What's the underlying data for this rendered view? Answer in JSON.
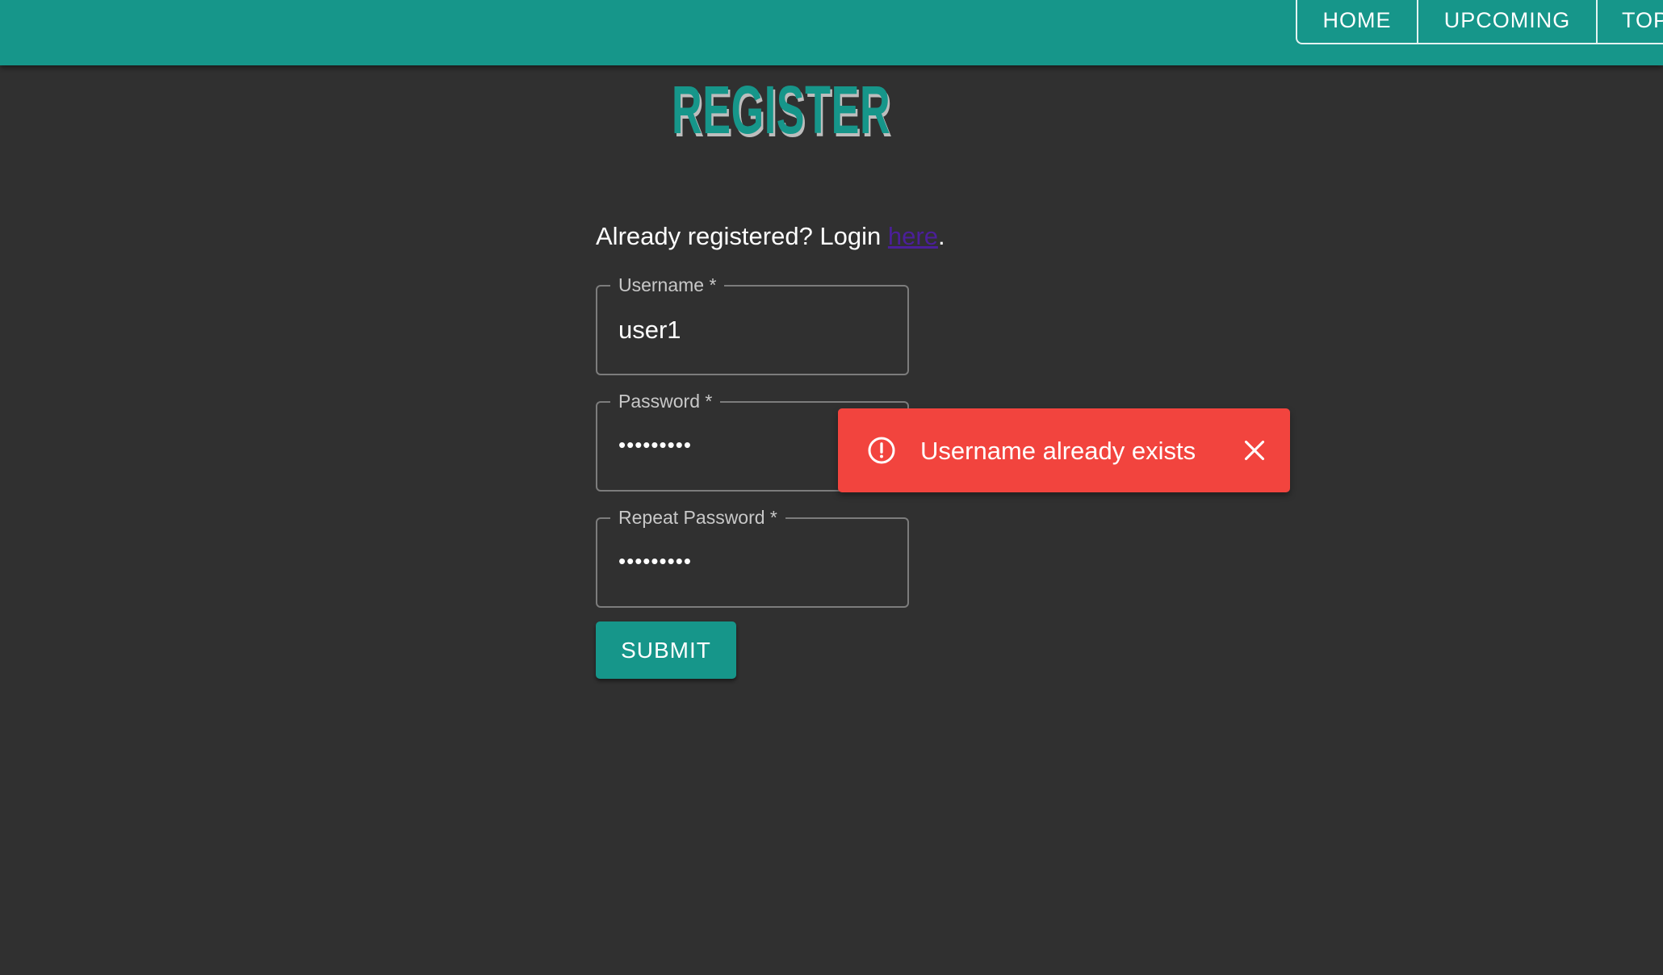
{
  "nav": {
    "items": [
      {
        "label": "HOME"
      },
      {
        "label": "UPCOMING"
      },
      {
        "label": "TOP"
      }
    ]
  },
  "page": {
    "title": "REGISTER"
  },
  "login_hint": {
    "prefix": "Already registered? Login ",
    "link_text": "here",
    "suffix": "."
  },
  "form": {
    "username": {
      "label": "Username *",
      "value": "user1"
    },
    "password": {
      "label": "Password *",
      "value": "•••••••••"
    },
    "repeat_password": {
      "label": "Repeat Password *",
      "value": "•••••••••"
    },
    "submit_label": "SUBMIT"
  },
  "toast": {
    "message": "Username already exists",
    "icon": "error-circle-icon",
    "close_icon": "close-icon",
    "background": "#f2443e"
  },
  "colors": {
    "accent": "#16968a",
    "background": "#303030",
    "link": "#4b1f99"
  }
}
